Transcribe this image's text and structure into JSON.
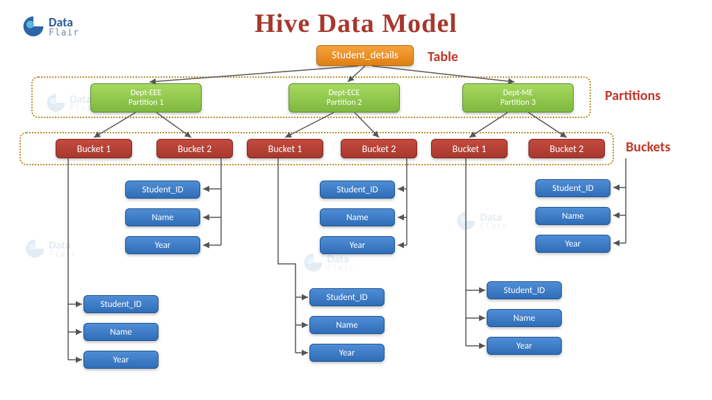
{
  "brand": {
    "line1": "Data",
    "line2": "Flair"
  },
  "title": "Hive Data Model",
  "table": {
    "name": "Student_details",
    "label": "Table"
  },
  "partitionsLabel": "Partitions",
  "bucketsLabel": "Buckets",
  "partitions": [
    {
      "dept": "Dept-EEE",
      "part": "Partition 1"
    },
    {
      "dept": "Dept-ECE",
      "part": "Partition 2"
    },
    {
      "dept": "Dept-ME",
      "part": "Partition 3"
    }
  ],
  "bucketLabels": {
    "b1": "Bucket  1",
    "b2": "Bucket 2",
    "p2b1": "Bucket 1",
    "p2b2": "Bucket 2",
    "p3b1": "Bucket 1",
    "p3b2": "Bucket 2"
  },
  "fields": {
    "id": "Student_ID",
    "name": "Name",
    "year": "Year"
  }
}
